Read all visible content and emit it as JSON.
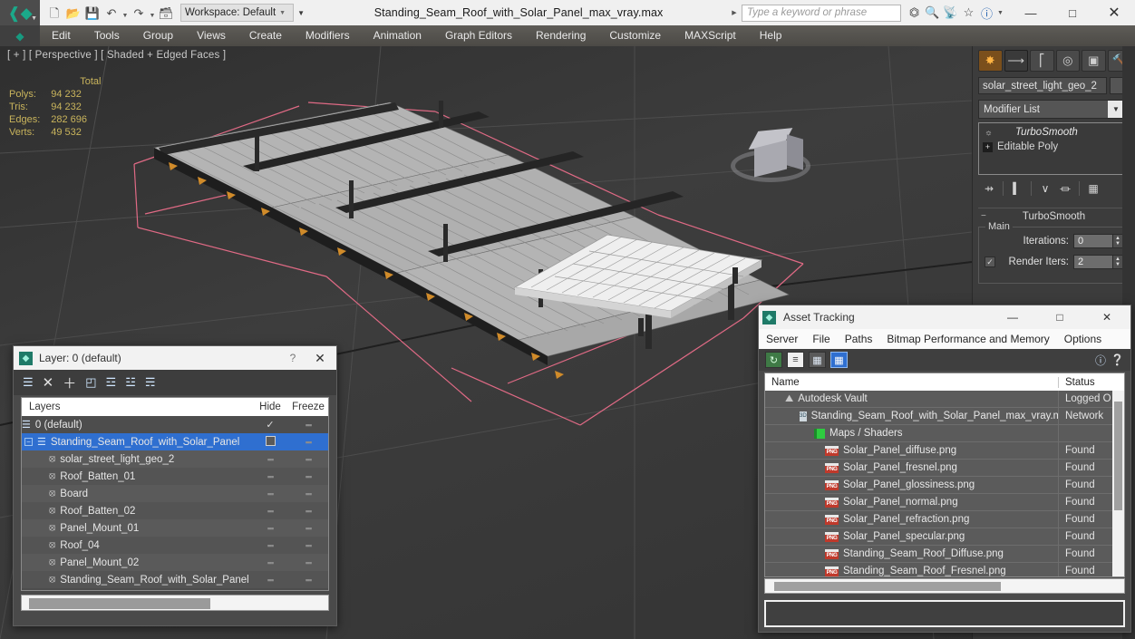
{
  "titlebar": {
    "app_icon": "3dsmax-logo-icon",
    "quick_access": [
      {
        "name": "new-file-button",
        "glyph": "⬜"
      },
      {
        "name": "open-file-button",
        "glyph": "📂"
      },
      {
        "name": "save-file-button",
        "glyph": "💾"
      },
      {
        "name": "undo-button",
        "glyph": "↶"
      },
      {
        "name": "redo-button",
        "glyph": "↷"
      },
      {
        "name": "set-project-folder-button",
        "glyph": "🗂"
      }
    ],
    "workspace_label": "Workspace: Default",
    "document_title": "Standing_Seam_Roof_with_Solar_Panel_max_vray.max",
    "search_placeholder": "Type a keyword or phrase",
    "right_icons": [
      {
        "name": "autodesk-app-store-icon",
        "glyph": "⚔"
      },
      {
        "name": "search-magnifier-icon",
        "glyph": "🔍"
      },
      {
        "name": "share-view-icon",
        "glyph": "📡"
      },
      {
        "name": "favorites-star-icon",
        "glyph": "☆"
      },
      {
        "name": "help-icon",
        "glyph": "?"
      }
    ],
    "window_controls": {
      "minimize": "—",
      "maximize": "□",
      "close": "✕"
    }
  },
  "menubar": {
    "items": [
      "Edit",
      "Tools",
      "Group",
      "Views",
      "Create",
      "Modifiers",
      "Animation",
      "Graph Editors",
      "Rendering",
      "Customize",
      "MAXScript",
      "Help"
    ]
  },
  "viewport": {
    "label": "[ + ] [ Perspective ] [ Shaded + Edged Faces ]",
    "stats_header": "Total",
    "stats": [
      {
        "key": "Polys:",
        "value": "94 232"
      },
      {
        "key": "Tris:",
        "value": "94 232"
      },
      {
        "key": "Edges:",
        "value": "282 696"
      },
      {
        "key": "Verts:",
        "value": "49 532"
      }
    ],
    "navcube_name": "view-cube"
  },
  "command_panel": {
    "tabs": [
      {
        "name": "create-tab",
        "glyph": "✸",
        "active": false
      },
      {
        "name": "modify-tab",
        "glyph": "➦",
        "active": true
      },
      {
        "name": "hierarchy-tab",
        "glyph": "⑂",
        "active": false
      },
      {
        "name": "motion-tab",
        "glyph": "◎",
        "active": false
      },
      {
        "name": "display-tab",
        "glyph": "▣",
        "active": false
      },
      {
        "name": "utilities-tab",
        "glyph": "🔨",
        "active": false
      }
    ],
    "object_name": "solar_street_light_geo_2",
    "modifier_list_label": "Modifier List",
    "stack": [
      {
        "name": "TurboSmooth",
        "selected": true
      },
      {
        "name": "Editable Poly",
        "selected": false
      }
    ],
    "stack_tools": [
      {
        "name": "pin-stack-icon",
        "glyph": "⊸"
      },
      {
        "name": "show-end-result-icon",
        "glyph": "❙"
      },
      {
        "name": "make-unique-icon",
        "glyph": "⅄"
      },
      {
        "name": "remove-modifier-icon",
        "glyph": "⛃"
      },
      {
        "name": "configure-modifier-sets-icon",
        "glyph": "▤"
      }
    ],
    "rollout": {
      "title": "TurboSmooth",
      "group_label": "Main",
      "iterations_label": "Iterations:",
      "iterations_value": "0",
      "render_iters_label": "Render Iters:",
      "render_iters_value": "2",
      "render_iters_checked": "✓"
    }
  },
  "layer_dialog": {
    "title": "Layer: 0 (default)",
    "help_glyph": "?",
    "close_glyph": "✕",
    "toolbar": [
      {
        "name": "create-new-layer-icon",
        "glyph": "☰"
      },
      {
        "name": "delete-layer-icon",
        "glyph": "✕"
      },
      {
        "name": "add-selection-to-layer-icon",
        "glyph": "＋"
      },
      {
        "name": "select-objects-in-layer-icon",
        "glyph": "◰"
      },
      {
        "name": "select-highlighted-objects-icon",
        "glyph": "☲"
      },
      {
        "name": "highlight-selected-objects-icon",
        "glyph": "☳"
      },
      {
        "name": "new-layer-from-selection-icon",
        "glyph": "☴"
      }
    ],
    "columns": [
      "Layers",
      "Hide",
      "Freeze"
    ],
    "rows": [
      {
        "label": "0 (default)",
        "indent": 0,
        "icon": "layer-icon",
        "selected": false,
        "hide": "✓",
        "freeze": "",
        "box": false
      },
      {
        "label": "Standing_Seam_Roof_with_Solar_Panel",
        "indent": 0,
        "icon": "layer-icon",
        "selected": true,
        "hide": "",
        "freeze": "",
        "box": true,
        "expander": "−"
      },
      {
        "label": "solar_street_light_geo_2",
        "indent": 1,
        "icon": "object-icon",
        "selected": false,
        "hide": "",
        "freeze": "",
        "box": false
      },
      {
        "label": "Roof_Batten_01",
        "indent": 1,
        "icon": "object-icon",
        "selected": false,
        "hide": "",
        "freeze": "",
        "box": false
      },
      {
        "label": "Board",
        "indent": 1,
        "icon": "object-icon",
        "selected": false,
        "hide": "",
        "freeze": "",
        "box": false
      },
      {
        "label": "Roof_Batten_02",
        "indent": 1,
        "icon": "object-icon",
        "selected": false,
        "hide": "",
        "freeze": "",
        "box": false
      },
      {
        "label": "Panel_Mount_01",
        "indent": 1,
        "icon": "object-icon",
        "selected": false,
        "hide": "",
        "freeze": "",
        "box": false
      },
      {
        "label": "Roof_04",
        "indent": 1,
        "icon": "object-icon",
        "selected": false,
        "hide": "",
        "freeze": "",
        "box": false
      },
      {
        "label": "Panel_Mount_02",
        "indent": 1,
        "icon": "object-icon",
        "selected": false,
        "hide": "",
        "freeze": "",
        "box": false
      },
      {
        "label": "Standing_Seam_Roof_with_Solar_Panel",
        "indent": 1,
        "icon": "object-icon",
        "selected": false,
        "hide": "",
        "freeze": "",
        "box": false
      }
    ]
  },
  "asset_dialog": {
    "title": "Asset Tracking",
    "window_controls": {
      "minimize": "—",
      "maximize": "□",
      "close": "✕"
    },
    "menu": [
      "Server",
      "File",
      "Paths",
      "Bitmap Performance and Memory",
      "Options"
    ],
    "toolbar": [
      {
        "name": "refresh-icon",
        "glyph": "↻",
        "style": "green"
      },
      {
        "name": "list-view-icon",
        "glyph": "≡",
        "style": "white"
      },
      {
        "name": "thumbnail-view-icon",
        "glyph": "▦",
        "style": "plain"
      },
      {
        "name": "grid-view-icon",
        "glyph": "▦",
        "style": "sel"
      }
    ],
    "help_icons": [
      {
        "name": "help-question-icon",
        "glyph": "?"
      },
      {
        "name": "context-help-icon",
        "glyph": "?"
      }
    ],
    "columns": [
      "Name",
      "Status"
    ],
    "rows": [
      {
        "name": "Autodesk Vault",
        "status": "Logged O",
        "indent": 1,
        "icon": "vault-icon"
      },
      {
        "name": "Standing_Seam_Roof_with_Solar_Panel_max_vray.max",
        "status": "Network",
        "indent": 2,
        "icon": "max-file-icon"
      },
      {
        "name": "Maps / Shaders",
        "status": "",
        "indent": 3,
        "icon": "maps-shaders-icon"
      },
      {
        "name": "Solar_Panel_diffuse.png",
        "status": "Found",
        "indent": 4,
        "icon": "png-icon"
      },
      {
        "name": "Solar_Panel_fresnel.png",
        "status": "Found",
        "indent": 4,
        "icon": "png-icon"
      },
      {
        "name": "Solar_Panel_glossiness.png",
        "status": "Found",
        "indent": 4,
        "icon": "png-icon"
      },
      {
        "name": "Solar_Panel_normal.png",
        "status": "Found",
        "indent": 4,
        "icon": "png-icon"
      },
      {
        "name": "Solar_Panel_refraction.png",
        "status": "Found",
        "indent": 4,
        "icon": "png-icon"
      },
      {
        "name": "Solar_Panel_specular.png",
        "status": "Found",
        "indent": 4,
        "icon": "png-icon"
      },
      {
        "name": "Standing_Seam_Roof_Diffuse.png",
        "status": "Found",
        "indent": 4,
        "icon": "png-icon"
      },
      {
        "name": "Standing_Seam_Roof_Fresnel.png",
        "status": "Found",
        "indent": 4,
        "icon": "png-icon"
      }
    ]
  },
  "colors": {
    "accent_blue": "#2f6fd0",
    "stats_yellow": "#c9b45c",
    "pink_helper": "#e06a85",
    "viewport_bg": "#3a3a3a",
    "panel_bg": "#3c3c3c"
  }
}
